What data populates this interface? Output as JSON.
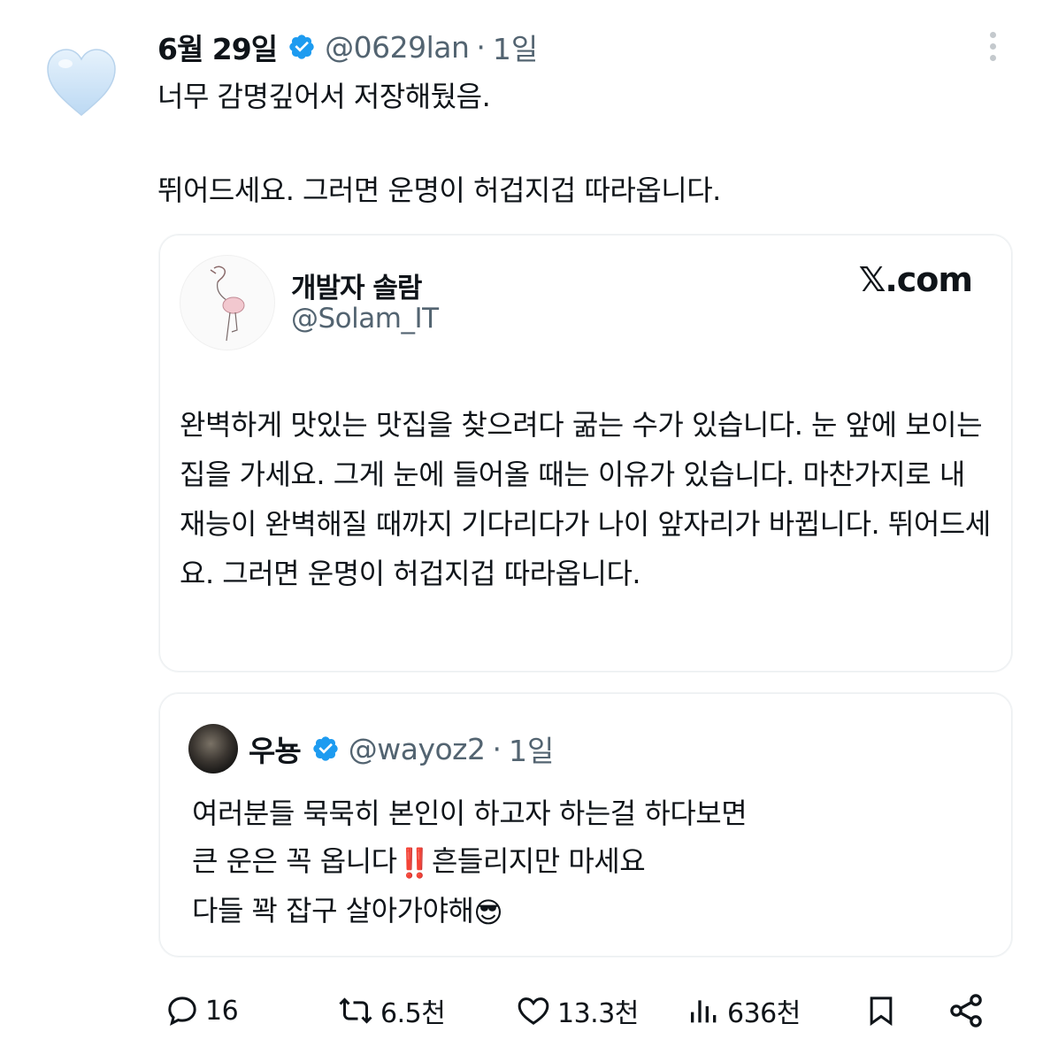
{
  "tweet": {
    "display_name": "6월 29일",
    "handle": "@0629lan",
    "separator": "·",
    "time": "1일",
    "text_line1": "너무 감명깊어서 저장해뒀음.",
    "text_line2": "뛰어드세요. 그러면 운명이 허겁지겁 따라옵니다."
  },
  "quoted_card": {
    "display_name": "개발자 솔람",
    "handle": "@Solam_IT",
    "source": "𝕏.com",
    "body": "완벽하게 맛있는 맛집을 찾으려다 굶는 수가 있습니다. 눈 앞에 보이는 집을 가세요. 그게 눈에 들어올 때는 이유가 있습니다. 마찬가지로 내 재능이 완벽해질 때까지 기다리다가 나이 앞자리가 바뀝니다. 뛰어드세요. 그러면 운명이 허겁지겁 따라옵니다."
  },
  "nested_quote": {
    "display_name": "우뇽",
    "handle": "@wayoz2",
    "separator": "·",
    "time": "1일",
    "line1": "여러분들 묵묵히 본인이 하고자 하는걸 하다보면",
    "line2": "큰 운은 꼭 옵니다",
    "line2_emoji": "‼️",
    "line2_rest": "흔들리지만 마세요",
    "line3": "다들 꽉 잡구 살아가야해",
    "line3_emoji": "😎"
  },
  "actions": {
    "replies": "16",
    "reposts": "6.5천",
    "likes": "13.3천",
    "views": "636천"
  },
  "colors": {
    "text": "#0f1419",
    "secondary": "#536471",
    "verified": "#1d9bf0",
    "heart": "#cfe4f8"
  },
  "icons": [
    "light-blue-heart-icon",
    "verified-badge-icon",
    "more-icon",
    "reply-icon",
    "repost-icon",
    "like-icon",
    "views-icon",
    "bookmark-icon",
    "share-icon"
  ]
}
